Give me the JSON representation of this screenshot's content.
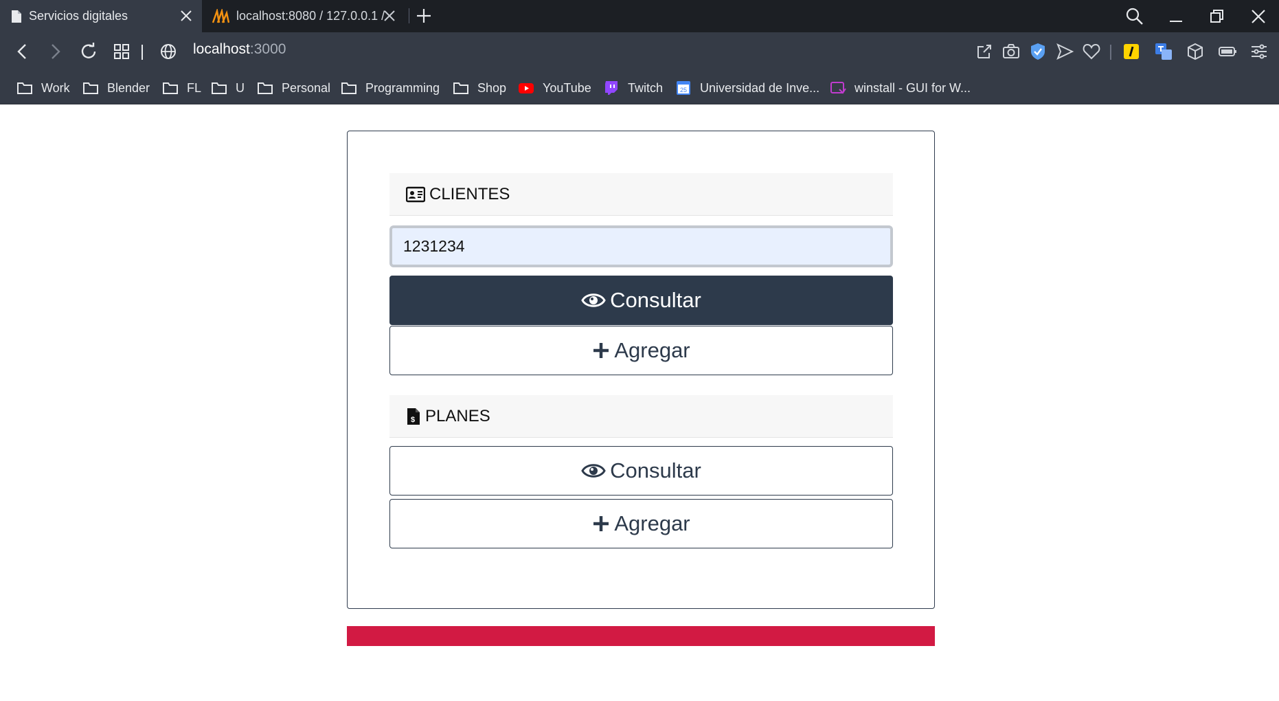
{
  "browser": {
    "tabs": [
      {
        "label": "Servicios digitales",
        "active": true
      },
      {
        "label": "localhost:8080 / 127.0.0.1 /",
        "active": false
      }
    ],
    "url_host": "localhost",
    "url_port": ":3000",
    "bookmarks": [
      "Work",
      "Blender",
      "FL",
      "U",
      "Personal",
      "Programming",
      "Shop",
      "YouTube",
      "Twitch",
      "Universidad de Inve...",
      "winstall - GUI for W..."
    ]
  },
  "colors": {
    "primary": "#2d3a4b",
    "accent": "#d21a43",
    "input_bg": "#e8f0fe"
  },
  "clientes": {
    "title": "CLIENTES",
    "input_value": "1231234",
    "consultar_label": "Consultar",
    "agregar_label": "Agregar"
  },
  "planes": {
    "title": "PLANES",
    "consultar_label": "Consultar",
    "agregar_label": "Agregar"
  }
}
